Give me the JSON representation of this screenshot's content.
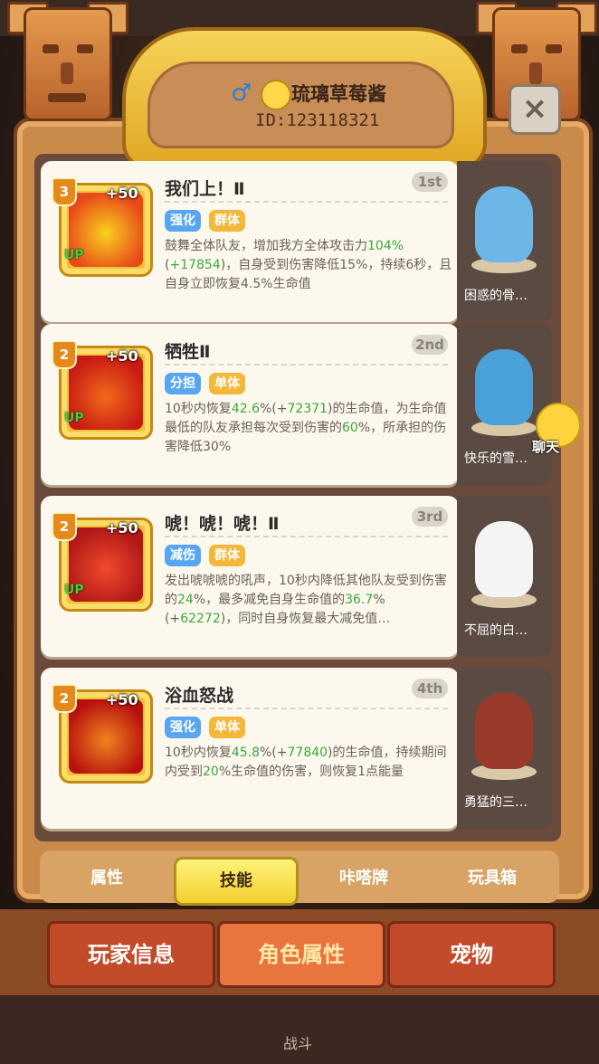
{
  "header": {
    "gender_icon": "male-symbol-icon",
    "gender_symbol": "♂",
    "player_name": "琉璃草莓酱",
    "player_id": "ID:123118321"
  },
  "close": {
    "symbol": "×"
  },
  "skills": [
    {
      "title": "我们上！Ⅱ",
      "rank": "1st",
      "level": "3",
      "bonus": "+50",
      "up": "UP",
      "tags": [
        "强化",
        "群体"
      ],
      "desc": [
        {
          "t": "鼓舞全体队友，增加我方全体攻击力"
        },
        {
          "t": "104%",
          "g": true
        },
        {
          "t": "("
        },
        {
          "t": "+17854",
          "g": true
        },
        {
          "t": ")，自身受到伤害降低15%，持续6秒，且自身立即恢复4.5%生命值"
        }
      ],
      "pet_name": "困惑的骨…",
      "icon_colors": [
        "#e8481a",
        "#f8d11d"
      ]
    },
    {
      "title": "牺牲Ⅱ",
      "rank": "2nd",
      "level": "2",
      "bonus": "+50",
      "up": "UP",
      "tags": [
        "分担",
        "单体"
      ],
      "desc": [
        {
          "t": "10秒内恢复"
        },
        {
          "t": "42.6",
          "g": true
        },
        {
          "t": "%(+"
        },
        {
          "t": "72371",
          "g": true
        },
        {
          "t": ")的生命值，为生命值最低的队友承担每次受到伤害的"
        },
        {
          "t": "60",
          "g": true
        },
        {
          "t": "%，所承担的伤害降低30%"
        }
      ],
      "pet_name": "快乐的雪…",
      "icon_colors": [
        "#c81a14",
        "#f06a1a"
      ]
    },
    {
      "title": "唬！唬！唬！Ⅱ",
      "rank": "3rd",
      "level": "2",
      "bonus": "+50",
      "up": "UP",
      "tags": [
        "减伤",
        "群体"
      ],
      "desc": [
        {
          "t": "发出唬唬唬的吼声，10秒内降低其他队友受到伤害的"
        },
        {
          "t": "24",
          "g": true
        },
        {
          "t": "%，最多减免自身生命值的"
        },
        {
          "t": "36.7",
          "g": true
        },
        {
          "t": "%(+"
        },
        {
          "t": "62272",
          "g": true
        },
        {
          "t": ")，同时自身恢复最大减免值…"
        }
      ],
      "pet_name": "不屈的白…",
      "icon_colors": [
        "#b01818",
        "#f04a2a"
      ]
    },
    {
      "title": "浴血怒战",
      "rank": "4th",
      "level": "2",
      "bonus": "+50",
      "up": "",
      "tags": [
        "强化",
        "单体"
      ],
      "desc": [
        {
          "t": "10秒内恢复"
        },
        {
          "t": "45.8",
          "g": true
        },
        {
          "t": "%(+"
        },
        {
          "t": "77840",
          "g": true
        },
        {
          "t": ")的生命值，持续期间内受到"
        },
        {
          "t": "20",
          "g": true
        },
        {
          "t": "%生命值的伤害，则恢复1点能量"
        }
      ],
      "pet_name": "勇猛的三…",
      "icon_colors": [
        "#b8100e",
        "#f0841e"
      ]
    }
  ],
  "chat": {
    "label": "聊天"
  },
  "tabs": [
    {
      "label": "属性",
      "active": false
    },
    {
      "label": "技能",
      "active": true
    },
    {
      "label": "咔嗒牌",
      "active": false
    },
    {
      "label": "玩具箱",
      "active": false
    }
  ],
  "nav": [
    {
      "label": "玩家信息",
      "active": false
    },
    {
      "label": "角色属性",
      "active": true
    },
    {
      "label": "宠物",
      "active": false
    }
  ],
  "bottom": {
    "battle_label": "战斗"
  },
  "colors": {
    "green_value": "#3aa839",
    "tag_blue": "#58a6ef",
    "tag_yellow": "#f3b73a"
  }
}
